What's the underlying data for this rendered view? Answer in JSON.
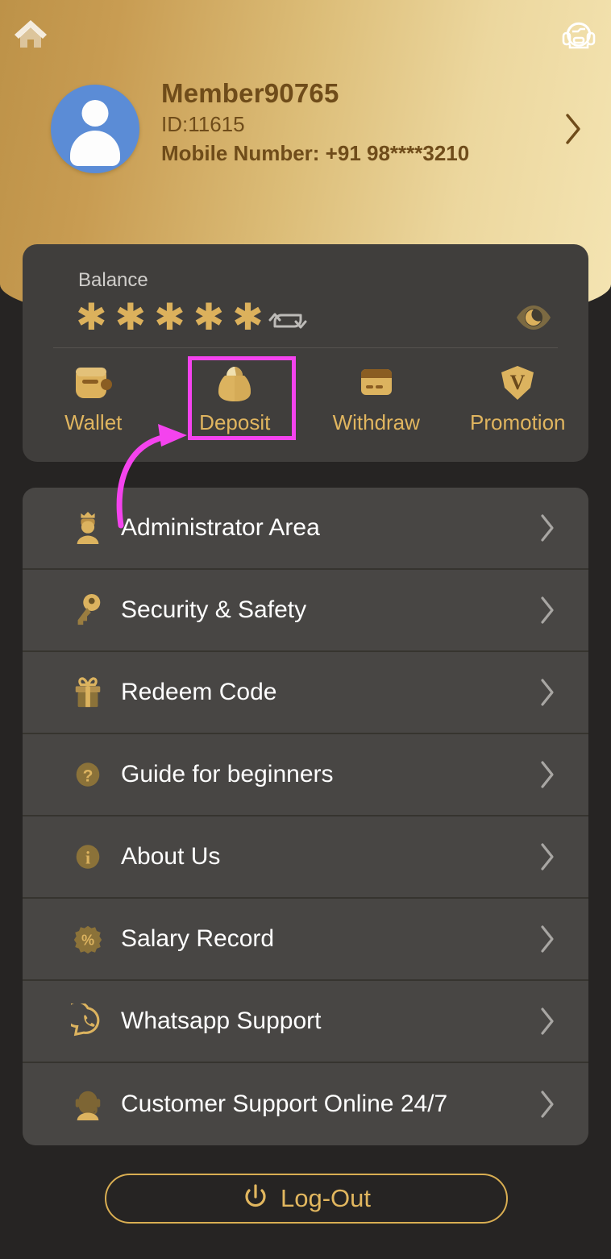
{
  "header": {
    "home_icon": "home-icon",
    "support_icon": "headset-support-icon",
    "avatar_icon": "user-avatar-icon",
    "member_name": "Member90765",
    "member_id": "ID:11615",
    "mobile_number": "Mobile Number: +91 98****3210",
    "chevron_icon": "chevron-right-icon",
    "gradient_start": "#bd9248",
    "gradient_end": "#f4e4b2",
    "text_color": "#6f4c1a"
  },
  "balance_card": {
    "label": "Balance",
    "masked_value": "✱✱✱✱✱",
    "refresh_icon": "refresh-icon",
    "eye_icon": "eye-visibility-icon",
    "bg_color": "#403e3c",
    "accent_color": "#dcb15c",
    "actions": [
      {
        "label": "Wallet",
        "icon": "wallet-icon",
        "highlighted": false
      },
      {
        "label": "Deposit",
        "icon": "money-bag-icon",
        "highlighted": true
      },
      {
        "label": "Withdraw",
        "icon": "bank-card-icon",
        "highlighted": false
      },
      {
        "label": "Promotion",
        "icon": "gem-v-icon",
        "highlighted": false
      }
    ]
  },
  "annotation": {
    "highlight_color": "#f443ee",
    "target_label": "Deposit",
    "shape": "rectangle-with-curved-arrow"
  },
  "menu": {
    "items": [
      {
        "label": "Administrator Area",
        "icon": "crown-user-icon",
        "chevron": "chevron-right-icon"
      },
      {
        "label": "Security & Safety",
        "icon": "key-icon",
        "chevron": "chevron-right-icon"
      },
      {
        "label": "Redeem Code",
        "icon": "gift-box-icon",
        "chevron": "chevron-right-icon"
      },
      {
        "label": "Guide for beginners",
        "icon": "question-mark-icon",
        "chevron": "chevron-right-icon"
      },
      {
        "label": "About Us",
        "icon": "info-icon",
        "chevron": "chevron-right-icon"
      },
      {
        "label": "Salary Record",
        "icon": "percent-badge-icon",
        "chevron": "chevron-right-icon"
      },
      {
        "label": "Whatsapp Support",
        "icon": "whatsapp-icon",
        "chevron": "chevron-right-icon"
      },
      {
        "label": "Customer Support Online 24/7",
        "icon": "headset-agent-icon",
        "chevron": "chevron-right-icon"
      }
    ]
  },
  "logout": {
    "label": "Log-Out",
    "icon": "power-icon",
    "border_color": "#d9ae52",
    "text_color": "#e2b75f"
  }
}
